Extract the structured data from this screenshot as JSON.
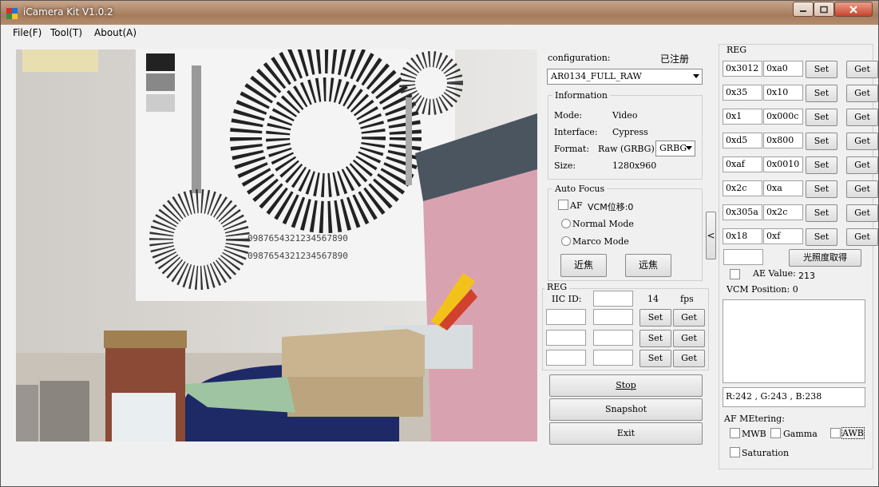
{
  "window": {
    "title": "iCamera Kit V1.0.2"
  },
  "menu": [
    "File(F)",
    "Tool(T)",
    "About(A)"
  ],
  "config": {
    "label": "configuration:",
    "registered": "已注册",
    "selected": "AR0134_FULL_RAW"
  },
  "information": {
    "title": "Information",
    "mode_label": "Mode:",
    "mode_value": "Video",
    "interface_label": "Interface:",
    "interface_value": "Cypress",
    "format_label": "Format:",
    "format_value": "Raw (GRBG)",
    "format_select": "GRBG",
    "size_label": "Size:",
    "size_value": "1280x960"
  },
  "autofocus": {
    "title": "Auto Focus",
    "af_label": "AF",
    "vcm_label": "VCM位移:0",
    "normal_mode": "Normal Mode",
    "marco_mode": "Marco Mode",
    "near_button": "近焦",
    "far_button": "远焦"
  },
  "reg_small": {
    "title": "REG",
    "iic_label": "IIC ID:",
    "fps_value": "14",
    "fps_label": "fps",
    "set_label": "Set",
    "get_label": "Get"
  },
  "actions": {
    "stop": "Stop",
    "snapshot": "Snapshot",
    "exit": "Exit"
  },
  "collapse_glyph": "<",
  "reg_panel": {
    "title": "REG",
    "rows": [
      {
        "addr": "0x3012",
        "val": "0xa0"
      },
      {
        "addr": "0x35",
        "val": "0x10"
      },
      {
        "addr": "0x1",
        "val": "0x000c"
      },
      {
        "addr": "0xd5",
        "val": "0x800"
      },
      {
        "addr": "0xaf",
        "val": "0x0010"
      },
      {
        "addr": "0x2c",
        "val": "0xa"
      },
      {
        "addr": "0x305a",
        "val": "0x2c"
      },
      {
        "addr": "0x18",
        "val": "0xf"
      }
    ],
    "set_label": "Set",
    "get_label": "Get",
    "illum_button": "光照度取得",
    "ae_label": "AE Value:",
    "ae_value": "213",
    "vcm_position": "VCM Position:  0",
    "rgb_text": "R:242 , G:243 , B:238",
    "af_metering": "AF MEtering:",
    "mwb": "MWB",
    "gamma": "Gamma",
    "awb": "AWB",
    "saturation": "Saturation"
  },
  "colors": {
    "title_bg": "#a67c5d",
    "window_bg": "#f0f0f0",
    "close_red": "#c9432c"
  }
}
